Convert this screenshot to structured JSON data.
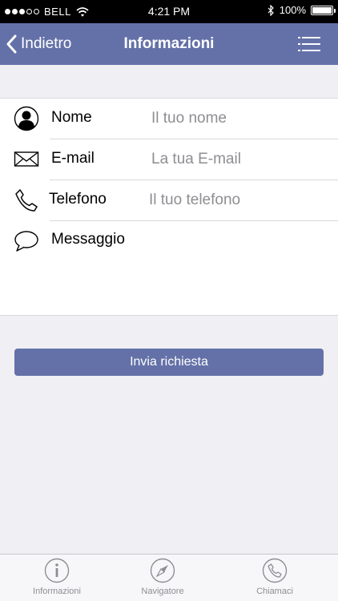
{
  "status_bar": {
    "carrier": "BELL",
    "time": "4:21 PM",
    "battery": "100%",
    "battery_level": 1.0
  },
  "nav": {
    "back_label": "Indietro",
    "title": "Informazioni",
    "icons": {
      "back": "chevron-left-icon",
      "menu": "list-menu-icon"
    }
  },
  "form": {
    "fields": [
      {
        "label": "Nome",
        "placeholder": "Il tuo nome",
        "icon": "user-silhouette-icon"
      },
      {
        "label": "E-mail",
        "placeholder": "La tua E-mail",
        "icon": "envelope-icon"
      },
      {
        "label": "Telefono",
        "placeholder": "Il tuo telefono",
        "icon": "phone-icon"
      },
      {
        "label": "Messaggio",
        "placeholder": "",
        "icon": "speech-bubble-icon"
      }
    ]
  },
  "submit_label": "Invia richiesta",
  "tabs": [
    {
      "label": "Informazioni",
      "icon": "info-icon"
    },
    {
      "label": "Navigatore",
      "icon": "compass-icon"
    },
    {
      "label": "Chiamaci",
      "icon": "phone-icon"
    }
  ],
  "colors": {
    "accent": "#6471a8",
    "background": "#efeff4",
    "tab_text": "#8e8e93"
  }
}
